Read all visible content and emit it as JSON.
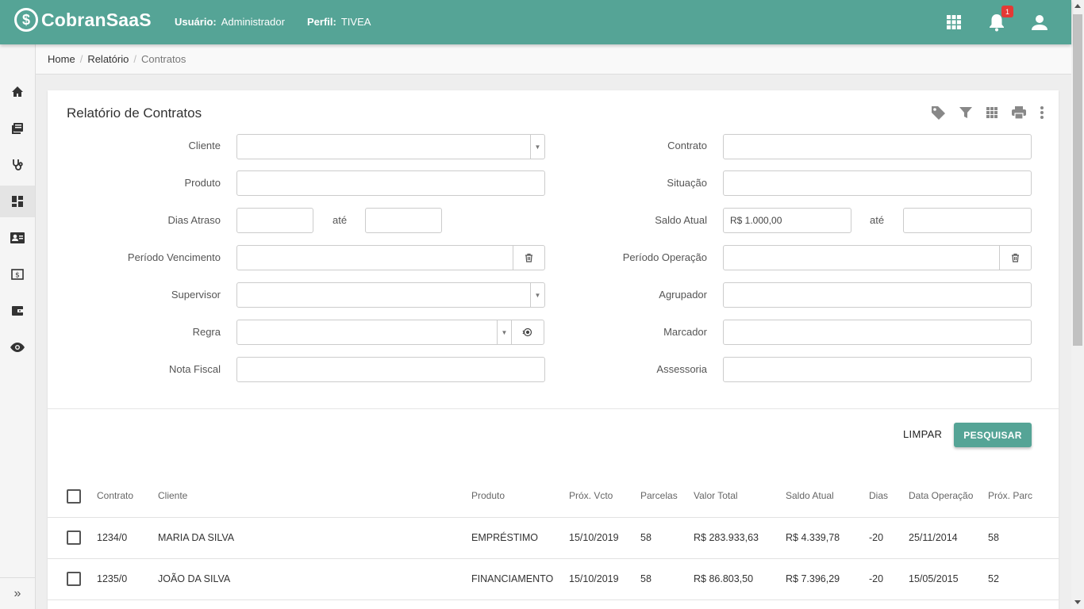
{
  "header": {
    "brand": "CobranSaaS",
    "user_label": "Usuário:",
    "user_value": "Administrador",
    "profile_label": "Perfil:",
    "profile_value": "TIVEA",
    "notification_count": "1",
    "bg_color": "#55a496"
  },
  "breadcrumb": {
    "home": "Home",
    "section": "Relatório",
    "current": "Contratos"
  },
  "sidebar": {
    "items": [
      "home-icon",
      "book-icon",
      "stethoscope-icon",
      "dashboard-icon",
      "contact-card-icon",
      "money-icon",
      "wallet-icon",
      "eye-icon"
    ],
    "active_index": 3,
    "expand": "»"
  },
  "page": {
    "title": "Relatório de Contratos"
  },
  "filters": {
    "cliente": {
      "label": "Cliente",
      "value": ""
    },
    "contrato": {
      "label": "Contrato",
      "value": ""
    },
    "produto": {
      "label": "Produto",
      "value": ""
    },
    "situacao": {
      "label": "Situação",
      "value": ""
    },
    "dias_atraso": {
      "label": "Dias Atraso",
      "from": "",
      "to": ""
    },
    "saldo_atual": {
      "label": "Saldo Atual",
      "from": "R$ 1.000,00",
      "to": ""
    },
    "ate": "até",
    "periodo_vencimento": {
      "label": "Período Vencimento",
      "value": ""
    },
    "periodo_operacao": {
      "label": "Período Operação",
      "value": ""
    },
    "supervisor": {
      "label": "Supervisor",
      "value": ""
    },
    "agrupador": {
      "label": "Agrupador",
      "value": ""
    },
    "regra": {
      "label": "Regra",
      "value": ""
    },
    "marcador": {
      "label": "Marcador",
      "value": ""
    },
    "nota_fiscal": {
      "label": "Nota Fiscal",
      "value": ""
    },
    "assessoria": {
      "label": "Assessoria",
      "value": ""
    }
  },
  "actions": {
    "clear": "LIMPAR",
    "search": "PESQUISAR"
  },
  "table": {
    "columns": [
      "Contrato",
      "Cliente",
      "Produto",
      "Próx. Vcto",
      "Parcelas",
      "Valor Total",
      "Saldo Atual",
      "Dias",
      "Data Operação",
      "Próx. Parc"
    ],
    "rows": [
      [
        "1234/0",
        "MARIA DA SILVA",
        "EMPRÉSTIMO",
        "15/10/2019",
        "58",
        "R$ 283.933,63",
        "R$ 4.339,78",
        "-20",
        "25/11/2014",
        "58"
      ],
      [
        "1235/0",
        "JOÃO DA SILVA",
        "FINANCIAMENTO",
        "15/10/2019",
        "58",
        "R$ 86.803,50",
        "R$ 7.396,29",
        "-20",
        "15/05/2015",
        "52"
      ]
    ]
  }
}
